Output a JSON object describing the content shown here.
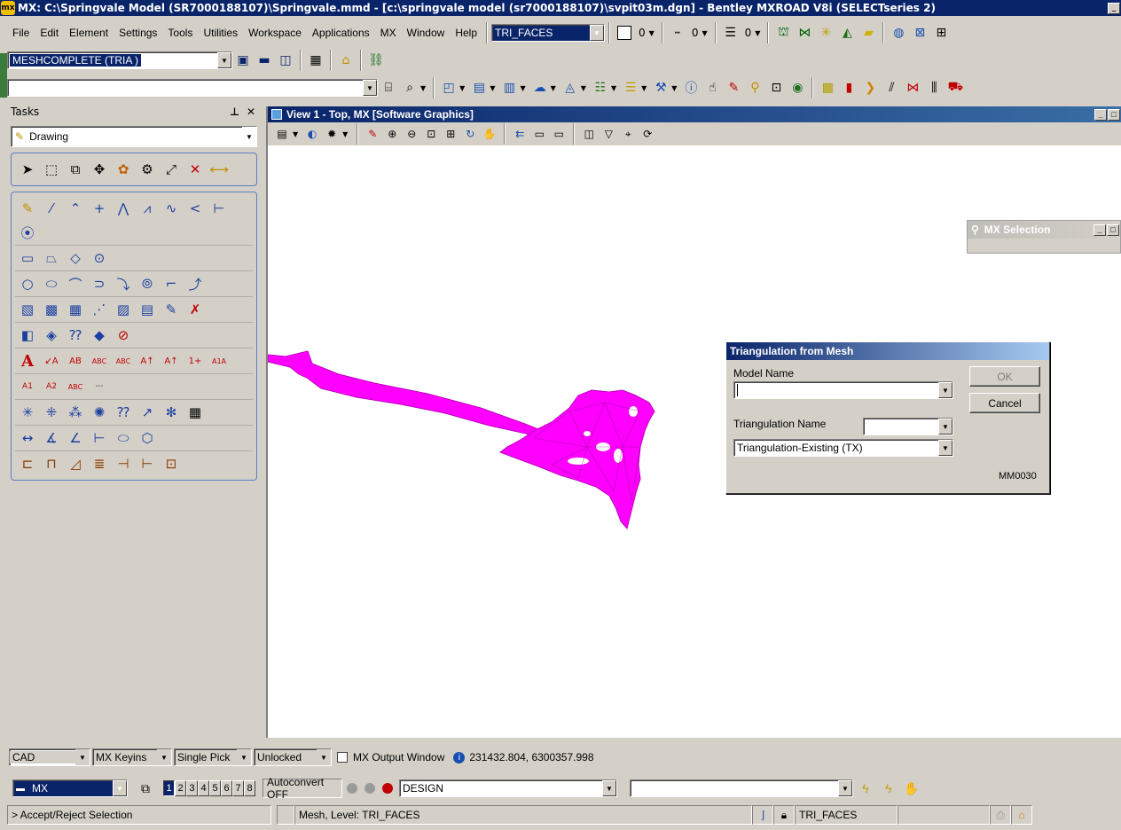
{
  "app": {
    "title": "MX: C:\\Springvale Model (SR7000188107)\\Springvale.mmd - [c:\\springvale model (sr7000188107)\\svpit03m.dgn] - Bentley MXROAD V8i (SELECTseries 2)",
    "icon_text": "mx"
  },
  "menu": [
    "File",
    "Edit",
    "Element",
    "Settings",
    "Tools",
    "Utilities",
    "Workspace",
    "Applications",
    "MX",
    "Window",
    "Help"
  ],
  "attributes": {
    "level": "TRI_FACES",
    "color": "0",
    "style": "0",
    "weight": "0"
  },
  "model_combo": "MESHCOMPLETE (TRIA )",
  "keyin_combo": "",
  "tasks": {
    "title": "Tasks",
    "pin": "ⰾ",
    "close": "✕",
    "current": "Drawing"
  },
  "view": {
    "title": "View 1 - Top, MX [Software Graphics]"
  },
  "mx_selection": {
    "title": "MX Selection"
  },
  "dialog": {
    "title": "Triangulation from Mesh",
    "model_name_label": "Model Name",
    "model_name_value": "",
    "triangulation_name_label": "Triangulation Name",
    "triangulation_name_value": "",
    "triangulation_type_value": "Triangulation-Existing (TX)",
    "ok_label": "OK",
    "cancel_label": "Cancel",
    "code": "MM0030"
  },
  "bottom": {
    "cad": "CAD",
    "keyins": "MX Keyins",
    "pick": "Single Pick",
    "lock": "Unlocked",
    "output_window": "MX Output Window",
    "coords": "231432.804, 6300357.998",
    "workspace": "MX",
    "views": [
      "1",
      "2",
      "3",
      "4",
      "5",
      "6",
      "7",
      "8"
    ],
    "autoconvert": "Autoconvert OFF",
    "design": "DESIGN",
    "right_combo": ""
  },
  "status": {
    "prompt": "> Accept/Reject Selection",
    "message": "Mesh, Level: TRI_FACES",
    "level": "TRI_FACES"
  },
  "colors": {
    "mesh": "#ff00ff",
    "titlebar": "#0a246a"
  }
}
